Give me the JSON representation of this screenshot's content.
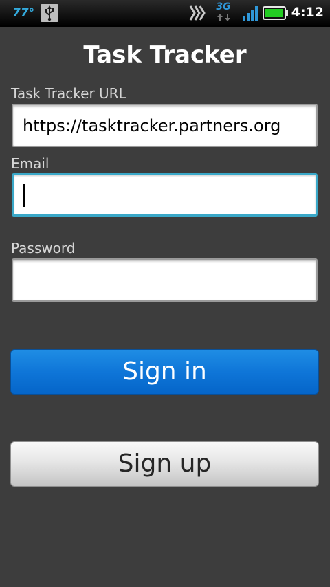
{
  "status_bar": {
    "temperature": "77°",
    "network_type": "3G",
    "time": "4:12",
    "icons": [
      "usb-icon",
      "sync-icon",
      "network-3g-icon",
      "signal-icon",
      "battery-icon"
    ],
    "colors": {
      "temperature": "#33aadd",
      "network": "#2f97d8",
      "battery": "#22cc22"
    }
  },
  "title": "Task Tracker",
  "form": {
    "url": {
      "label": "Task Tracker URL",
      "value": "https://tasktracker.partners.org"
    },
    "email": {
      "label": "Email",
      "value": ""
    },
    "password": {
      "label": "Password",
      "value": ""
    }
  },
  "buttons": {
    "sign_in": "Sign in",
    "sign_up": "Sign up"
  },
  "colors": {
    "background": "#3d3d3d",
    "sign_in": "#0f76d8",
    "focus_border": "#3aa8c8"
  }
}
